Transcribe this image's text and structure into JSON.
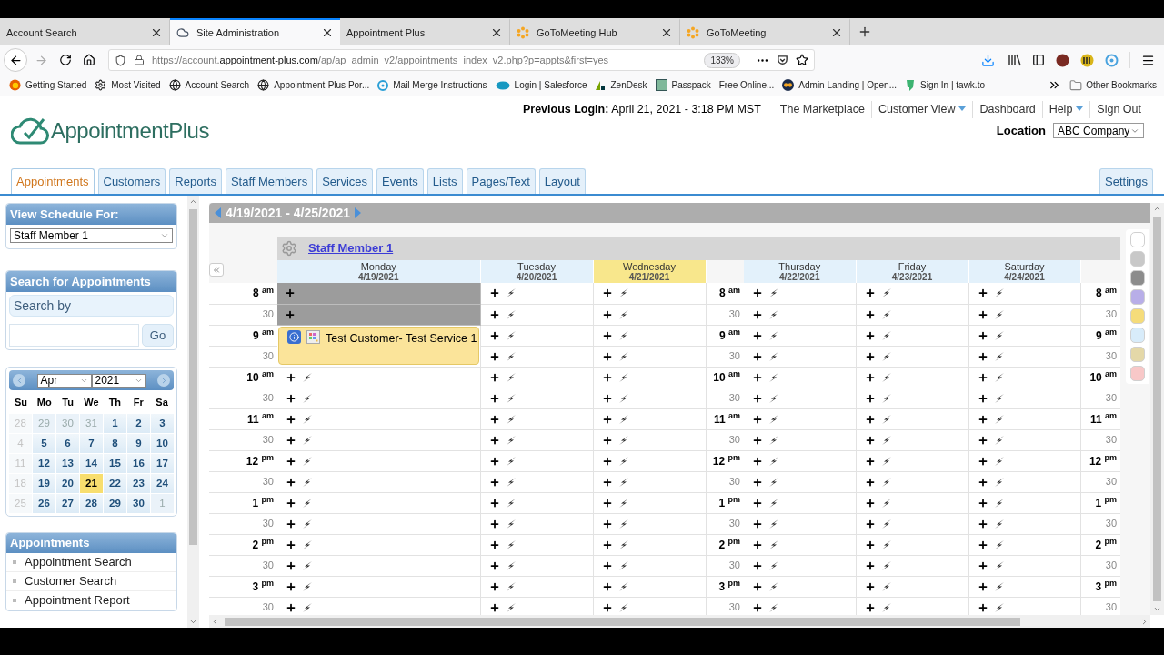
{
  "browser": {
    "tabs": [
      {
        "title": "Account Search",
        "kind": "plain",
        "selected": false
      },
      {
        "title": "Site Administration",
        "kind": "cloud",
        "selected": true
      },
      {
        "title": "Appointment Plus",
        "kind": "plain",
        "selected": false
      },
      {
        "title": "GoToMeeting Hub",
        "kind": "asterisk",
        "selected": false
      },
      {
        "title": "GoToMeeting",
        "kind": "asterisk",
        "selected": false
      }
    ],
    "url": {
      "scheme": "https://account.",
      "domain": "appointment-plus.com",
      "path": "/ap/ap_admin_v2/appointments_index_v2.php?p=appts&first=yes"
    },
    "zoom": "133%",
    "bookmarks": [
      {
        "label": "Getting Started",
        "kind": "firefox"
      },
      {
        "label": "Most Visited",
        "kind": "gear"
      },
      {
        "label": "Account Search",
        "kind": "globe"
      },
      {
        "label": "Appointment-Plus Por...",
        "kind": "globe"
      },
      {
        "label": "Mail Merge Instructions",
        "kind": "dot"
      },
      {
        "label": "Login | Salesforce",
        "kind": "cloud"
      },
      {
        "label": "ZenDesk",
        "kind": "zendesk"
      },
      {
        "label": "Passpack - Free Online...",
        "kind": "square"
      },
      {
        "label": "Admin Landing | Open...",
        "kind": "owl"
      },
      {
        "label": "Sign In | tawk.to",
        "kind": "chat"
      }
    ],
    "other_bookmarks": "Other Bookmarks"
  },
  "header": {
    "previous_login": "**Previous Login:** April 21, 2021 - 3:18 PM MST",
    "links": [
      {
        "label": "The Marketplace",
        "dropdown": false
      },
      {
        "label": "Customer View",
        "dropdown": true
      },
      {
        "label": "Dashboard",
        "dropdown": false
      },
      {
        "label": "Help",
        "dropdown": true
      },
      {
        "label": "Sign Out",
        "dropdown": false
      }
    ],
    "logo": "AppointmentPlus",
    "location": {
      "label": "Location",
      "value": "ABC Company"
    }
  },
  "nav_tabs": [
    {
      "label": "Appointments",
      "selected": true
    },
    {
      "label": "Customers",
      "selected": false
    },
    {
      "label": "Reports",
      "selected": false
    },
    {
      "label": "Staff Members",
      "selected": false
    },
    {
      "label": "Services",
      "selected": false
    },
    {
      "label": "Events",
      "selected": false
    },
    {
      "label": "Lists",
      "selected": false
    },
    {
      "label": "Pages/Text",
      "selected": false
    },
    {
      "label": "Layout",
      "selected": false
    }
  ],
  "settings_tab": "Settings",
  "sidebar": {
    "schedule": {
      "title": "View Schedule For:",
      "value": "Staff Member 1"
    },
    "search": {
      "title": "Search for Appointments",
      "placeholder": "Search by",
      "button": "Go"
    },
    "calendar": {
      "month": "Apr",
      "year": "2021",
      "weekdays": [
        "Su",
        "Mo",
        "Tu",
        "We",
        "Th",
        "Fr",
        "Sa"
      ],
      "weeks": [
        [
          {
            "day": "28",
            "kind": "off",
            "selected": false
          },
          {
            "day": "29",
            "kind": "outside",
            "selected": false
          },
          {
            "day": "30",
            "kind": "outside",
            "selected": false
          },
          {
            "day": "31",
            "kind": "outside",
            "selected": false
          },
          {
            "day": "1",
            "kind": "day",
            "selected": false
          },
          {
            "day": "2",
            "kind": "day",
            "selected": false
          },
          {
            "day": "3",
            "kind": "day",
            "selected": false
          }
        ],
        [
          {
            "day": "4",
            "kind": "off",
            "selected": false
          },
          {
            "day": "5",
            "kind": "day",
            "selected": false
          },
          {
            "day": "6",
            "kind": "day",
            "selected": false
          },
          {
            "day": "7",
            "kind": "day",
            "selected": false
          },
          {
            "day": "8",
            "kind": "day",
            "selected": false
          },
          {
            "day": "9",
            "kind": "day",
            "selected": false
          },
          {
            "day": "10",
            "kind": "day",
            "selected": false
          }
        ],
        [
          {
            "day": "11",
            "kind": "off",
            "selected": false
          },
          {
            "day": "12",
            "kind": "day",
            "selected": false
          },
          {
            "day": "13",
            "kind": "day",
            "selected": false
          },
          {
            "day": "14",
            "kind": "day",
            "selected": false
          },
          {
            "day": "15",
            "kind": "day",
            "selected": false
          },
          {
            "day": "16",
            "kind": "day",
            "selected": false
          },
          {
            "day": "17",
            "kind": "day",
            "selected": false
          }
        ],
        [
          {
            "day": "18",
            "kind": "off",
            "selected": false
          },
          {
            "day": "19",
            "kind": "day",
            "selected": false
          },
          {
            "day": "20",
            "kind": "day",
            "selected": false
          },
          {
            "day": "21",
            "kind": "day",
            "selected": true
          },
          {
            "day": "22",
            "kind": "day",
            "selected": false
          },
          {
            "day": "23",
            "kind": "day",
            "selected": false
          },
          {
            "day": "24",
            "kind": "day",
            "selected": false
          }
        ],
        [
          {
            "day": "25",
            "kind": "off",
            "selected": false
          },
          {
            "day": "26",
            "kind": "day",
            "selected": false
          },
          {
            "day": "27",
            "kind": "day",
            "selected": false
          },
          {
            "day": "28",
            "kind": "day",
            "selected": false
          },
          {
            "day": "29",
            "kind": "day",
            "selected": false
          },
          {
            "day": "30",
            "kind": "day",
            "selected": false
          },
          {
            "day": "1",
            "kind": "outside",
            "selected": false
          }
        ]
      ]
    },
    "appointments": {
      "title": "Appointments",
      "links": [
        "Appointment Search",
        "Customer Search",
        "Appointment Report"
      ]
    }
  },
  "calendar": {
    "range": "4/19/2021 - 4/25/2021",
    "staff": "Staff Member 1",
    "time_columns": [
      [
        "8 $^{am}$",
        "30",
        "9 $^{am}$",
        "30",
        "10 $^{am}$",
        "30",
        "11 $^{am}$",
        "30",
        "12 $^{pm}$",
        "30",
        "1 $^{pm}$",
        "30",
        "2 $^{pm}$",
        "30",
        "3 $^{pm}$",
        "30"
      ],
      [
        "8 $^{am}$",
        "30",
        "9 $^{am}$",
        "30",
        "10 $^{am}$",
        "30",
        "11 $^{am}$",
        "30",
        "12 $^{pm}$",
        "30",
        "1 $^{pm}$",
        "30",
        "2 $^{pm}$",
        "30",
        "3 $^{pm}$",
        "30"
      ],
      [
        "8 $^{am}$",
        "30",
        "9 $^{am}$",
        "30",
        "10 $^{am}$",
        "30",
        "11 $^{am}$",
        "30",
        "12 $^{pm}$",
        "30",
        "1 $^{pm}$",
        "30",
        "2 $^{pm}$",
        "30",
        "3 $^{pm}$",
        "30"
      ]
    ],
    "days": [
      {
        "name": "Monday",
        "date": "4/19/2021",
        "selected": false,
        "appointment": "Test Customer- Test Service 1",
        "slots": [
          {
            "kind": "blocked"
          },
          {
            "kind": "blocked"
          },
          {
            "kind": "booked"
          },
          {
            "kind": "booked"
          },
          {
            "kind": "open"
          },
          {
            "kind": "open"
          },
          {
            "kind": "open"
          },
          {
            "kind": "open"
          },
          {
            "kind": "open"
          },
          {
            "kind": "open"
          },
          {
            "kind": "open"
          },
          {
            "kind": "open"
          },
          {
            "kind": "open"
          },
          {
            "kind": "open"
          },
          {
            "kind": "open"
          },
          {
            "kind": "open"
          }
        ]
      },
      {
        "name": "Tuesday",
        "date": "4/20/2021",
        "selected": false,
        "slots": [
          {
            "kind": "open"
          },
          {
            "kind": "open"
          },
          {
            "kind": "open"
          },
          {
            "kind": "open"
          },
          {
            "kind": "open"
          },
          {
            "kind": "open"
          },
          {
            "kind": "open"
          },
          {
            "kind": "open"
          },
          {
            "kind": "open"
          },
          {
            "kind": "open"
          },
          {
            "kind": "open"
          },
          {
            "kind": "open"
          },
          {
            "kind": "open"
          },
          {
            "kind": "open"
          },
          {
            "kind": "open"
          },
          {
            "kind": "open"
          }
        ]
      },
      {
        "name": "Wednesday",
        "date": "4/21/2021",
        "selected": true,
        "slots": [
          {
            "kind": "open"
          },
          {
            "kind": "open"
          },
          {
            "kind": "open"
          },
          {
            "kind": "open"
          },
          {
            "kind": "open"
          },
          {
            "kind": "open"
          },
          {
            "kind": "open"
          },
          {
            "kind": "open"
          },
          {
            "kind": "open"
          },
          {
            "kind": "open"
          },
          {
            "kind": "open"
          },
          {
            "kind": "open"
          },
          {
            "kind": "open"
          },
          {
            "kind": "open"
          },
          {
            "kind": "open"
          },
          {
            "kind": "open"
          }
        ]
      },
      {
        "name": "Thursday",
        "date": "4/22/2021",
        "selected": false,
        "slots": [
          {
            "kind": "open"
          },
          {
            "kind": "open"
          },
          {
            "kind": "open"
          },
          {
            "kind": "open"
          },
          {
            "kind": "open"
          },
          {
            "kind": "open"
          },
          {
            "kind": "open"
          },
          {
            "kind": "open"
          },
          {
            "kind": "open"
          },
          {
            "kind": "open"
          },
          {
            "kind": "open"
          },
          {
            "kind": "open"
          },
          {
            "kind": "open"
          },
          {
            "kind": "open"
          },
          {
            "kind": "open"
          },
          {
            "kind": "open"
          }
        ]
      },
      {
        "name": "Friday",
        "date": "4/23/2021",
        "selected": false,
        "slots": [
          {
            "kind": "open"
          },
          {
            "kind": "open"
          },
          {
            "kind": "open"
          },
          {
            "kind": "open"
          },
          {
            "kind": "open"
          },
          {
            "kind": "open"
          },
          {
            "kind": "open"
          },
          {
            "kind": "open"
          },
          {
            "kind": "open"
          },
          {
            "kind": "open"
          },
          {
            "kind": "open"
          },
          {
            "kind": "open"
          },
          {
            "kind": "open"
          },
          {
            "kind": "open"
          },
          {
            "kind": "open"
          },
          {
            "kind": "open"
          }
        ]
      },
      {
        "name": "Saturday",
        "date": "4/24/2021",
        "selected": false,
        "slots": [
          {
            "kind": "open"
          },
          {
            "kind": "open"
          },
          {
            "kind": "open"
          },
          {
            "kind": "open"
          },
          {
            "kind": "open"
          },
          {
            "kind": "open"
          },
          {
            "kind": "open"
          },
          {
            "kind": "open"
          },
          {
            "kind": "open"
          },
          {
            "kind": "open"
          },
          {
            "kind": "open"
          },
          {
            "kind": "open"
          },
          {
            "kind": "open"
          },
          {
            "kind": "open"
          },
          {
            "kind": "open"
          },
          {
            "kind": "open"
          }
        ]
      }
    ],
    "swatches": [
      {
        "color": "#ffffff"
      },
      {
        "color": "#c8c8c8"
      },
      {
        "color": "#8c8c8c"
      },
      {
        "color": "#b8aee8"
      },
      {
        "color": "#f5dc7a"
      },
      {
        "color": "#d8ecfa"
      },
      {
        "color": "#e4d8a8"
      },
      {
        "color": "#f8c8c8"
      }
    ]
  }
}
